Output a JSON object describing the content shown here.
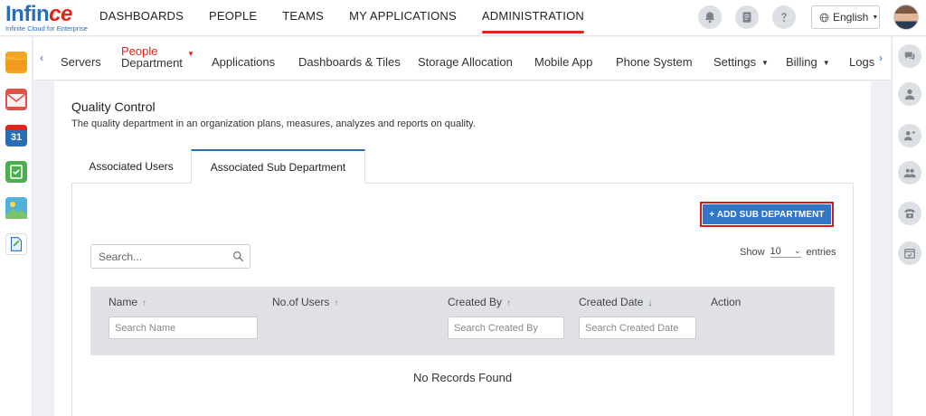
{
  "brand": {
    "name_main": "Infin",
    "name_accent": "ce",
    "tagline": "Infinite Cloud for Enterprise"
  },
  "main_nav": [
    "DASHBOARDS",
    "PEOPLE",
    "TEAMS",
    "MY APPLICATIONS",
    "ADMINISTRATION"
  ],
  "main_nav_active": "ADMINISTRATION",
  "header": {
    "language": "English",
    "icons": [
      "bell-icon",
      "notes-icon",
      "help-icon",
      "globe-icon"
    ]
  },
  "left_apps": [
    "folder-icon",
    "mail-icon",
    "calendar-icon",
    "tasks-icon",
    "photos-icon",
    "docs-icon"
  ],
  "calendar_day": "31",
  "right_apps": [
    "chat-icon",
    "user-icon",
    "user-switch-icon",
    "group-icon",
    "phone-icon",
    "calendar-check-icon"
  ],
  "sub_nav": {
    "active_line1": "People",
    "active_line2": "Department",
    "items": [
      "Servers",
      "Applications",
      "Dashboards & Tiles",
      "Storage Allocation",
      "Mobile App",
      "Phone System",
      "Settings",
      "Billing",
      "Logs"
    ]
  },
  "page": {
    "title": "Quality Control",
    "description": "The quality department in an organization plans, measures, analyzes and reports on quality."
  },
  "tabs": [
    "Associated Users",
    "Associated Sub Department"
  ],
  "active_tab": "Associated Sub Department",
  "add_button": "+ ADD SUB DEPARTMENT",
  "search": {
    "placeholder": "Search..."
  },
  "show_entries": {
    "label_before": "Show",
    "value": "10",
    "label_after": "entries"
  },
  "table": {
    "columns": [
      "Name",
      "No.of Users",
      "Created By",
      "Created Date",
      "Action"
    ],
    "filters": {
      "name": "Search Name",
      "created_by": "Search Created By",
      "created_date": "Search Created Date"
    },
    "empty_text": "No Records Found"
  },
  "colors": {
    "accent": "#2a6db5",
    "brand_red": "#e2231a",
    "button_blue": "#3375c6"
  }
}
